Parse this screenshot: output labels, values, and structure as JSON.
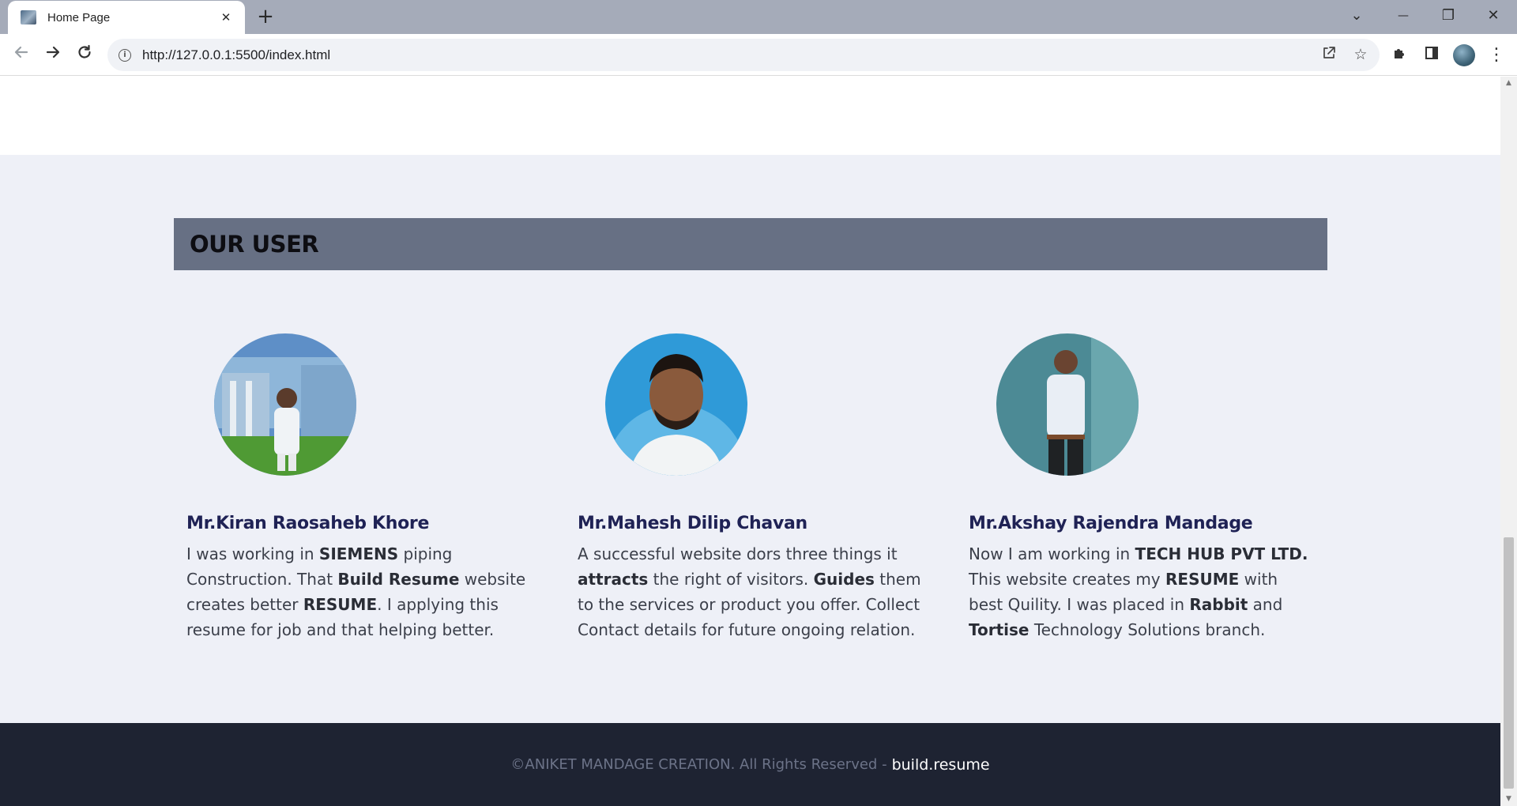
{
  "browser": {
    "tab_title": "Home Page",
    "tab_close": "✕",
    "new_tab": "+",
    "url": "http://127.0.0.1:5500/index.html",
    "window_controls": {
      "menu": "⌄",
      "minimize": "—",
      "restore": "❐",
      "close": "✕"
    },
    "icons": [
      "back-arrow-icon",
      "forward-arrow-icon",
      "reload-icon",
      "site-info-icon",
      "share-icon",
      "bookmark-star-icon",
      "extensions-puzzle-icon",
      "side-panel-icon",
      "profile-avatar",
      "kebab-menu-icon"
    ]
  },
  "section": {
    "title": "OUR USER"
  },
  "users": [
    {
      "name": "Mr.Kiran Raosaheb Khore",
      "text": [
        {
          "t": "I was working in "
        },
        {
          "t": "SIEMENS",
          "b": true
        },
        {
          "t": " piping Construction. That "
        },
        {
          "t": "Build Resume",
          "b": true
        },
        {
          "t": " website creates better "
        },
        {
          "t": "RESUME",
          "b": true
        },
        {
          "t": ". I applying this resume for job and that helping better."
        }
      ]
    },
    {
      "name": "Mr.Mahesh Dilip Chavan",
      "text": [
        {
          "t": "A successful website dors three things it "
        },
        {
          "t": "attracts",
          "b": true
        },
        {
          "t": " the right of visitors. "
        },
        {
          "t": "Guides",
          "b": true
        },
        {
          "t": " them to the services or product you offer. Collect Contact details for future ongoing relation."
        }
      ]
    },
    {
      "name": "Mr.Akshay Rajendra Mandage",
      "text": [
        {
          "t": "Now I am working in "
        },
        {
          "t": "TECH HUB PVT LTD.",
          "b": true
        },
        {
          "t": " This website creates my "
        },
        {
          "t": "RESUME",
          "b": true
        },
        {
          "t": " with best Quility. I was placed in "
        },
        {
          "t": "Rabbit",
          "b": true
        },
        {
          "t": " and "
        },
        {
          "t": "Tortise",
          "b": true
        },
        {
          "t": " Technology Solutions branch."
        }
      ]
    }
  ],
  "footer": {
    "copyright": "©ANIKET MANDAGE CREATION. All Rights Reserved -",
    "link": "build.resume"
  },
  "colors": {
    "section_bg": "#eef0f7",
    "header_bar": "#677084",
    "name_color": "#1f2255",
    "footer_bg": "#1e2332"
  }
}
